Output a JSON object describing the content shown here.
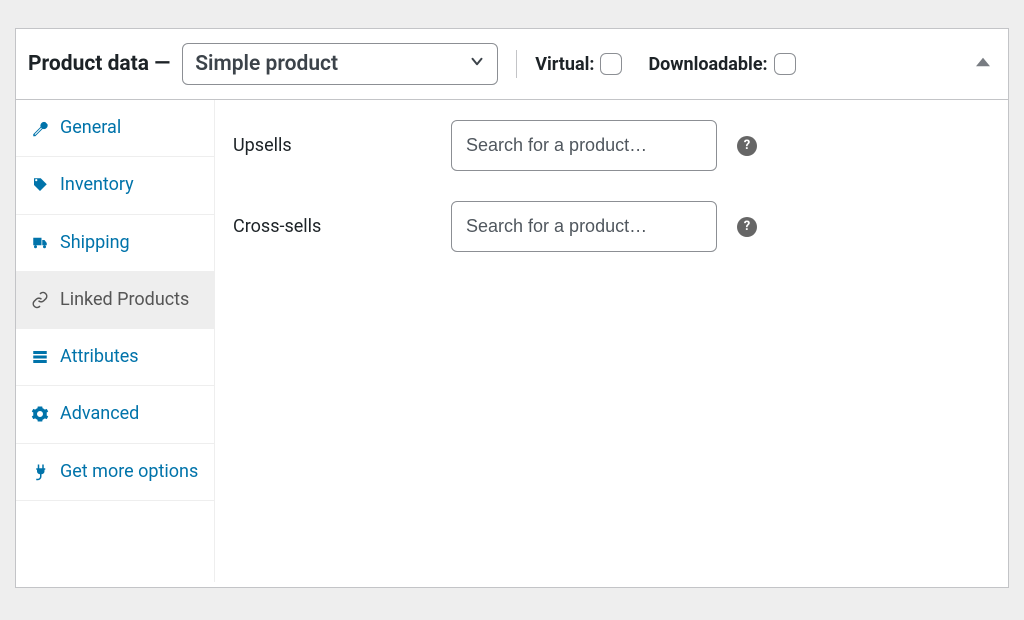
{
  "header": {
    "title_prefix": "Product data —",
    "product_type_selected": "Simple product",
    "virtual_label": "Virtual:",
    "downloadable_label": "Downloadable:",
    "virtual_checked": false,
    "downloadable_checked": false
  },
  "sidebar": {
    "items": [
      {
        "label": "General",
        "icon": "wrench-icon",
        "active": false
      },
      {
        "label": "Inventory",
        "icon": "tag-icon",
        "active": false
      },
      {
        "label": "Shipping",
        "icon": "truck-icon",
        "active": false
      },
      {
        "label": "Linked Products",
        "icon": "link-icon",
        "active": true
      },
      {
        "label": "Attributes",
        "icon": "list-icon",
        "active": false
      },
      {
        "label": "Advanced",
        "icon": "gear-icon",
        "active": false
      },
      {
        "label": "Get more options",
        "icon": "plug-icon",
        "active": false
      }
    ]
  },
  "content": {
    "upsells_label": "Upsells",
    "crosssells_label": "Cross-sells",
    "search_placeholder": "Search for a product…",
    "help_glyph": "?"
  },
  "colors": {
    "link": "#0073aa",
    "muted": "#555555",
    "border": "#c3c4c7",
    "bg_inactive": "#eeeeee"
  }
}
